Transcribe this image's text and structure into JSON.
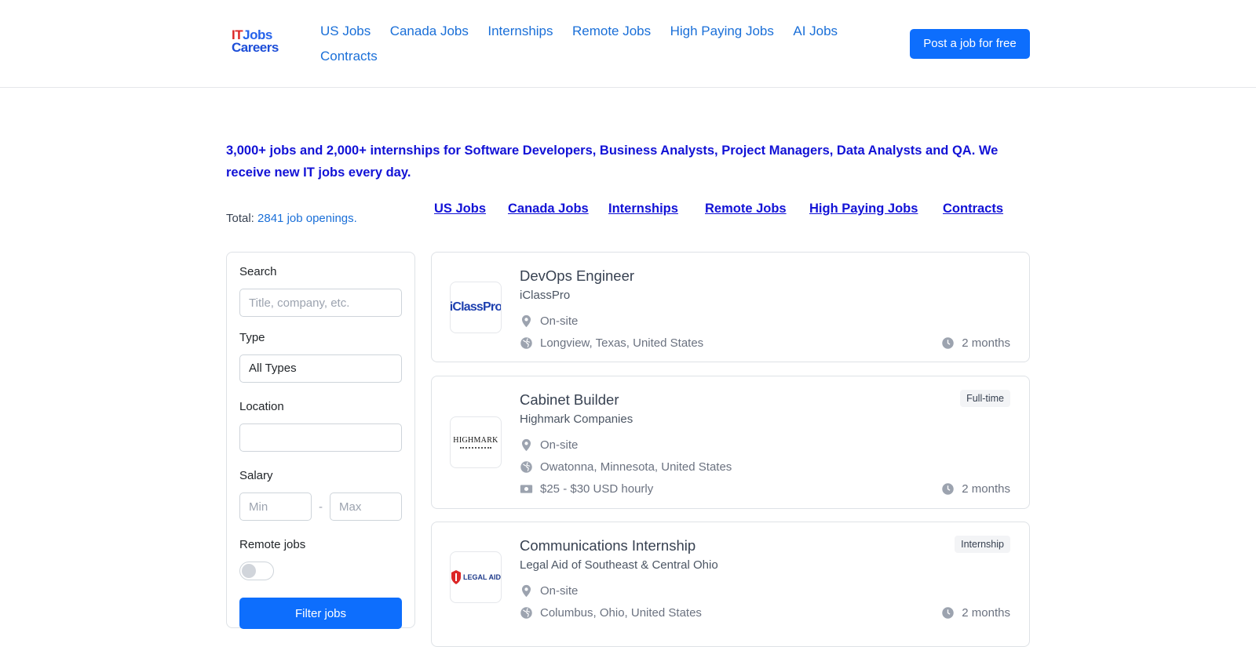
{
  "header": {
    "logo": {
      "it": "IT",
      "jobs": "Jobs",
      "careers": "Careers"
    },
    "nav": [
      "US Jobs",
      "Canada Jobs",
      "Internships",
      "Remote Jobs",
      "High Paying Jobs",
      "AI Jobs",
      "Contracts"
    ],
    "post_button": "Post a job for free"
  },
  "intro": "3,000+ jobs and 2,000+ internships for Software Developers, Business Analysts, Project Managers, Data Analysts and QA. We receive new IT jobs every day.",
  "total": {
    "label": "Total:",
    "count": "2841 job openings",
    "suffix": "."
  },
  "sublinks": [
    "US Jobs",
    "Canada Jobs",
    "Internships",
    "Remote Jobs",
    "High Paying Jobs",
    "Contracts"
  ],
  "filter": {
    "search_label": "Search",
    "search_placeholder": "Title, company, etc.",
    "type_label": "Type",
    "type_value": "All Types",
    "location_label": "Location",
    "location_value": "",
    "salary_label": "Salary",
    "salary_min_placeholder": "Min",
    "salary_dash": "-",
    "salary_max_placeholder": "Max",
    "remote_label": "Remote jobs",
    "remote_on": false,
    "button": "Filter jobs"
  },
  "jobs": [
    {
      "title": "DevOps Engineer",
      "company": "iClassPro",
      "logo_text": "iClassPro",
      "workplace": "On-site",
      "location": "Longview, Texas, United States",
      "age": "2 months",
      "badge": "",
      "salary": ""
    },
    {
      "title": "Cabinet Builder",
      "company": "Highmark Companies",
      "logo_text": "HIGHMARK",
      "workplace": "On-site",
      "location": "Owatonna, Minnesota, United States",
      "age": "2 months",
      "badge": "Full-time",
      "salary": "$25 - $30 USD hourly"
    },
    {
      "title": "Communications Internship",
      "company": "Legal Aid of Southeast & Central Ohio",
      "logo_text": "LEGAL AID",
      "workplace": "On-site",
      "location": "Columbus, Ohio, United States",
      "age": "2 months",
      "badge": "Internship",
      "salary": ""
    }
  ],
  "colors": {
    "primary": "#0d6efd",
    "link": "#1a6fd8",
    "intro": "#1212d6",
    "icon": "#9ca3af"
  }
}
